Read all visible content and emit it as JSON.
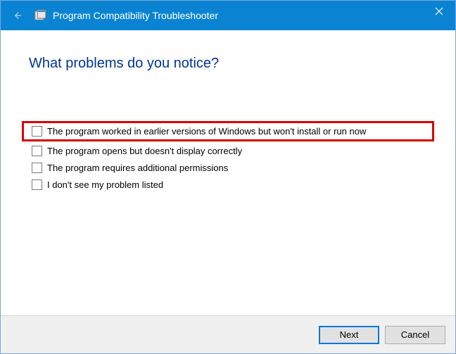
{
  "titlebar": {
    "title": "Program Compatibility Troubleshooter"
  },
  "heading": "What problems do you notice?",
  "options": [
    {
      "label": "The program worked in earlier versions of Windows but won't install or run now",
      "highlighted": true
    },
    {
      "label": "The program opens but doesn't display correctly",
      "highlighted": false
    },
    {
      "label": "The program requires additional permissions",
      "highlighted": false
    },
    {
      "label": "I don't see my problem listed",
      "highlighted": false
    }
  ],
  "footer": {
    "next": "Next",
    "cancel": "Cancel"
  }
}
